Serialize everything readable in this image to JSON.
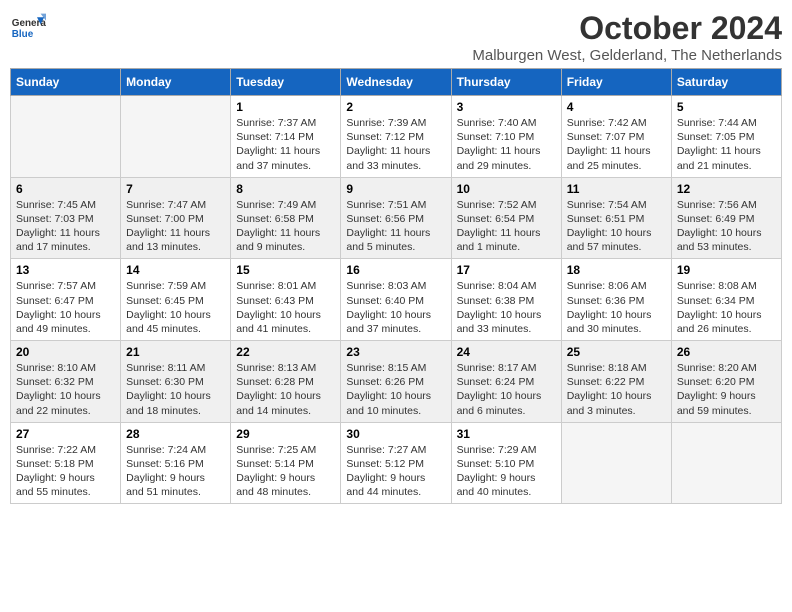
{
  "logo": {
    "general": "General",
    "blue": "Blue"
  },
  "title": "October 2024",
  "subtitle": "Malburgen West, Gelderland, The Netherlands",
  "days_of_week": [
    "Sunday",
    "Monday",
    "Tuesday",
    "Wednesday",
    "Thursday",
    "Friday",
    "Saturday"
  ],
  "weeks": [
    [
      {
        "day": null
      },
      {
        "day": null
      },
      {
        "day": "1",
        "sunrise": "Sunrise: 7:37 AM",
        "sunset": "Sunset: 7:14 PM",
        "daylight": "Daylight: 11 hours and 37 minutes."
      },
      {
        "day": "2",
        "sunrise": "Sunrise: 7:39 AM",
        "sunset": "Sunset: 7:12 PM",
        "daylight": "Daylight: 11 hours and 33 minutes."
      },
      {
        "day": "3",
        "sunrise": "Sunrise: 7:40 AM",
        "sunset": "Sunset: 7:10 PM",
        "daylight": "Daylight: 11 hours and 29 minutes."
      },
      {
        "day": "4",
        "sunrise": "Sunrise: 7:42 AM",
        "sunset": "Sunset: 7:07 PM",
        "daylight": "Daylight: 11 hours and 25 minutes."
      },
      {
        "day": "5",
        "sunrise": "Sunrise: 7:44 AM",
        "sunset": "Sunset: 7:05 PM",
        "daylight": "Daylight: 11 hours and 21 minutes."
      }
    ],
    [
      {
        "day": "6",
        "sunrise": "Sunrise: 7:45 AM",
        "sunset": "Sunset: 7:03 PM",
        "daylight": "Daylight: 11 hours and 17 minutes."
      },
      {
        "day": "7",
        "sunrise": "Sunrise: 7:47 AM",
        "sunset": "Sunset: 7:00 PM",
        "daylight": "Daylight: 11 hours and 13 minutes."
      },
      {
        "day": "8",
        "sunrise": "Sunrise: 7:49 AM",
        "sunset": "Sunset: 6:58 PM",
        "daylight": "Daylight: 11 hours and 9 minutes."
      },
      {
        "day": "9",
        "sunrise": "Sunrise: 7:51 AM",
        "sunset": "Sunset: 6:56 PM",
        "daylight": "Daylight: 11 hours and 5 minutes."
      },
      {
        "day": "10",
        "sunrise": "Sunrise: 7:52 AM",
        "sunset": "Sunset: 6:54 PM",
        "daylight": "Daylight: 11 hours and 1 minute."
      },
      {
        "day": "11",
        "sunrise": "Sunrise: 7:54 AM",
        "sunset": "Sunset: 6:51 PM",
        "daylight": "Daylight: 10 hours and 57 minutes."
      },
      {
        "day": "12",
        "sunrise": "Sunrise: 7:56 AM",
        "sunset": "Sunset: 6:49 PM",
        "daylight": "Daylight: 10 hours and 53 minutes."
      }
    ],
    [
      {
        "day": "13",
        "sunrise": "Sunrise: 7:57 AM",
        "sunset": "Sunset: 6:47 PM",
        "daylight": "Daylight: 10 hours and 49 minutes."
      },
      {
        "day": "14",
        "sunrise": "Sunrise: 7:59 AM",
        "sunset": "Sunset: 6:45 PM",
        "daylight": "Daylight: 10 hours and 45 minutes."
      },
      {
        "day": "15",
        "sunrise": "Sunrise: 8:01 AM",
        "sunset": "Sunset: 6:43 PM",
        "daylight": "Daylight: 10 hours and 41 minutes."
      },
      {
        "day": "16",
        "sunrise": "Sunrise: 8:03 AM",
        "sunset": "Sunset: 6:40 PM",
        "daylight": "Daylight: 10 hours and 37 minutes."
      },
      {
        "day": "17",
        "sunrise": "Sunrise: 8:04 AM",
        "sunset": "Sunset: 6:38 PM",
        "daylight": "Daylight: 10 hours and 33 minutes."
      },
      {
        "day": "18",
        "sunrise": "Sunrise: 8:06 AM",
        "sunset": "Sunset: 6:36 PM",
        "daylight": "Daylight: 10 hours and 30 minutes."
      },
      {
        "day": "19",
        "sunrise": "Sunrise: 8:08 AM",
        "sunset": "Sunset: 6:34 PM",
        "daylight": "Daylight: 10 hours and 26 minutes."
      }
    ],
    [
      {
        "day": "20",
        "sunrise": "Sunrise: 8:10 AM",
        "sunset": "Sunset: 6:32 PM",
        "daylight": "Daylight: 10 hours and 22 minutes."
      },
      {
        "day": "21",
        "sunrise": "Sunrise: 8:11 AM",
        "sunset": "Sunset: 6:30 PM",
        "daylight": "Daylight: 10 hours and 18 minutes."
      },
      {
        "day": "22",
        "sunrise": "Sunrise: 8:13 AM",
        "sunset": "Sunset: 6:28 PM",
        "daylight": "Daylight: 10 hours and 14 minutes."
      },
      {
        "day": "23",
        "sunrise": "Sunrise: 8:15 AM",
        "sunset": "Sunset: 6:26 PM",
        "daylight": "Daylight: 10 hours and 10 minutes."
      },
      {
        "day": "24",
        "sunrise": "Sunrise: 8:17 AM",
        "sunset": "Sunset: 6:24 PM",
        "daylight": "Daylight: 10 hours and 6 minutes."
      },
      {
        "day": "25",
        "sunrise": "Sunrise: 8:18 AM",
        "sunset": "Sunset: 6:22 PM",
        "daylight": "Daylight: 10 hours and 3 minutes."
      },
      {
        "day": "26",
        "sunrise": "Sunrise: 8:20 AM",
        "sunset": "Sunset: 6:20 PM",
        "daylight": "Daylight: 9 hours and 59 minutes."
      }
    ],
    [
      {
        "day": "27",
        "sunrise": "Sunrise: 7:22 AM",
        "sunset": "Sunset: 5:18 PM",
        "daylight": "Daylight: 9 hours and 55 minutes."
      },
      {
        "day": "28",
        "sunrise": "Sunrise: 7:24 AM",
        "sunset": "Sunset: 5:16 PM",
        "daylight": "Daylight: 9 hours and 51 minutes."
      },
      {
        "day": "29",
        "sunrise": "Sunrise: 7:25 AM",
        "sunset": "Sunset: 5:14 PM",
        "daylight": "Daylight: 9 hours and 48 minutes."
      },
      {
        "day": "30",
        "sunrise": "Sunrise: 7:27 AM",
        "sunset": "Sunset: 5:12 PM",
        "daylight": "Daylight: 9 hours and 44 minutes."
      },
      {
        "day": "31",
        "sunrise": "Sunrise: 7:29 AM",
        "sunset": "Sunset: 5:10 PM",
        "daylight": "Daylight: 9 hours and 40 minutes."
      },
      {
        "day": null
      },
      {
        "day": null
      }
    ]
  ]
}
